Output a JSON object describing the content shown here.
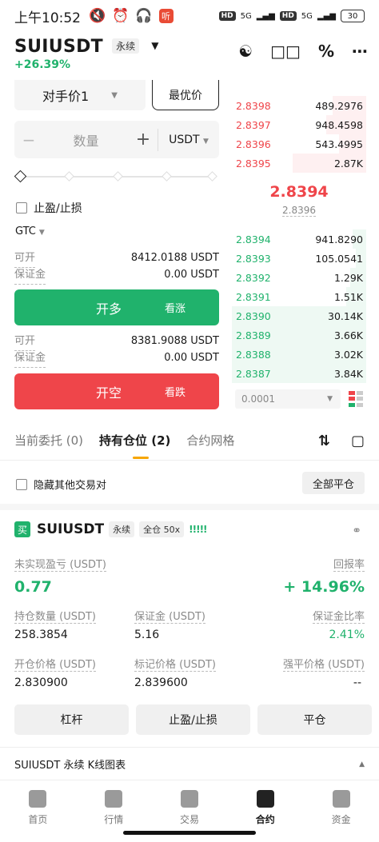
{
  "status_bar": {
    "time": "上午10:52",
    "app_badge": "听",
    "net1": "HD",
    "net1_type": "5G",
    "net2": "HD",
    "net2_type": "5G",
    "battery": "30"
  },
  "header": {
    "symbol": "SUIUSDT",
    "contract_tag": "永续",
    "change": "+26.39%"
  },
  "order_form": {
    "price_type": "对手价1",
    "best_price": "最优价",
    "qty_placeholder": "数量",
    "qty_minus": "−",
    "qty_plus": "+",
    "unit": "USDT",
    "tpsl_label": "止盈/止损",
    "tif": "GTC",
    "long": {
      "avail_label": "可开",
      "avail_value": "8412.0188 USDT",
      "margin_label": "保证金",
      "margin_value": "0.00 USDT",
      "button": "开多",
      "sub": "看涨"
    },
    "short": {
      "avail_label": "可开",
      "avail_value": "8381.9088 USDT",
      "margin_label": "保证金",
      "margin_value": "0.00 USDT",
      "button": "开空",
      "sub": "看跌"
    }
  },
  "orderbook": {
    "asks": [
      {
        "price": "2.8398",
        "qty": "489.2976",
        "depth": 0.25
      },
      {
        "price": "2.8397",
        "qty": "948.4598",
        "depth": 0.3
      },
      {
        "price": "2.8396",
        "qty": "543.4995",
        "depth": 0.2
      },
      {
        "price": "2.8395",
        "qty": "2.87K",
        "depth": 0.55
      }
    ],
    "last_price": "2.8394",
    "mark_price": "2.8396",
    "bids": [
      {
        "price": "2.8394",
        "qty": "941.8290",
        "depth": 0.1
      },
      {
        "price": "2.8393",
        "qty": "105.0541",
        "depth": 0.08
      },
      {
        "price": "2.8392",
        "qty": "1.29K",
        "depth": 0.12
      },
      {
        "price": "2.8391",
        "qty": "1.51K",
        "depth": 0.15
      },
      {
        "price": "2.8390",
        "qty": "30.14K",
        "depth": 1.0
      },
      {
        "price": "2.8389",
        "qty": "3.66K",
        "depth": 1.0
      },
      {
        "price": "2.8388",
        "qty": "3.02K",
        "depth": 1.0
      },
      {
        "price": "2.8387",
        "qty": "3.84K",
        "depth": 1.0
      }
    ],
    "precision": "0.0001"
  },
  "tabs": [
    {
      "label": "当前委托 (0)"
    },
    {
      "label": "持有仓位 (2)"
    },
    {
      "label": "合约网格"
    }
  ],
  "positions_toolbar": {
    "hide_other": "隐藏其他交易对",
    "close_all": "全部平仓"
  },
  "position": {
    "side_badge": "买",
    "symbol": "SUIUSDT",
    "contract_tag": "永续",
    "margin_mode": "全仓 50x",
    "pnl_label": "未实现盈亏 (USDT)",
    "pnl_value": "0.77",
    "roe_label": "回报率",
    "roe_value": "+ 14.96%",
    "size_label": "持仓数量 (USDT)",
    "size_value": "258.3854",
    "margin_label": "保证金 (USDT)",
    "margin_value": "5.16",
    "margin_ratio_label": "保证金比率",
    "margin_ratio_value": "2.41%",
    "entry_label": "开仓价格 (USDT)",
    "entry_value": "2.830900",
    "mark_label": "标记价格 (USDT)",
    "mark_value": "2.839600",
    "liq_label": "强平价格 (USDT)",
    "liq_value": "--",
    "buttons": {
      "leverage": "杠杆",
      "tpsl": "止盈/止损",
      "close": "平仓"
    }
  },
  "kline_label": "SUIUSDT 永续 K线图表",
  "bottom_nav": [
    {
      "label": "首页"
    },
    {
      "label": "行情"
    },
    {
      "label": "交易"
    },
    {
      "label": "合约"
    },
    {
      "label": "资金"
    }
  ],
  "colors": {
    "green": "#20b26c",
    "red": "#ef454a",
    "accent": "#f7a600"
  }
}
